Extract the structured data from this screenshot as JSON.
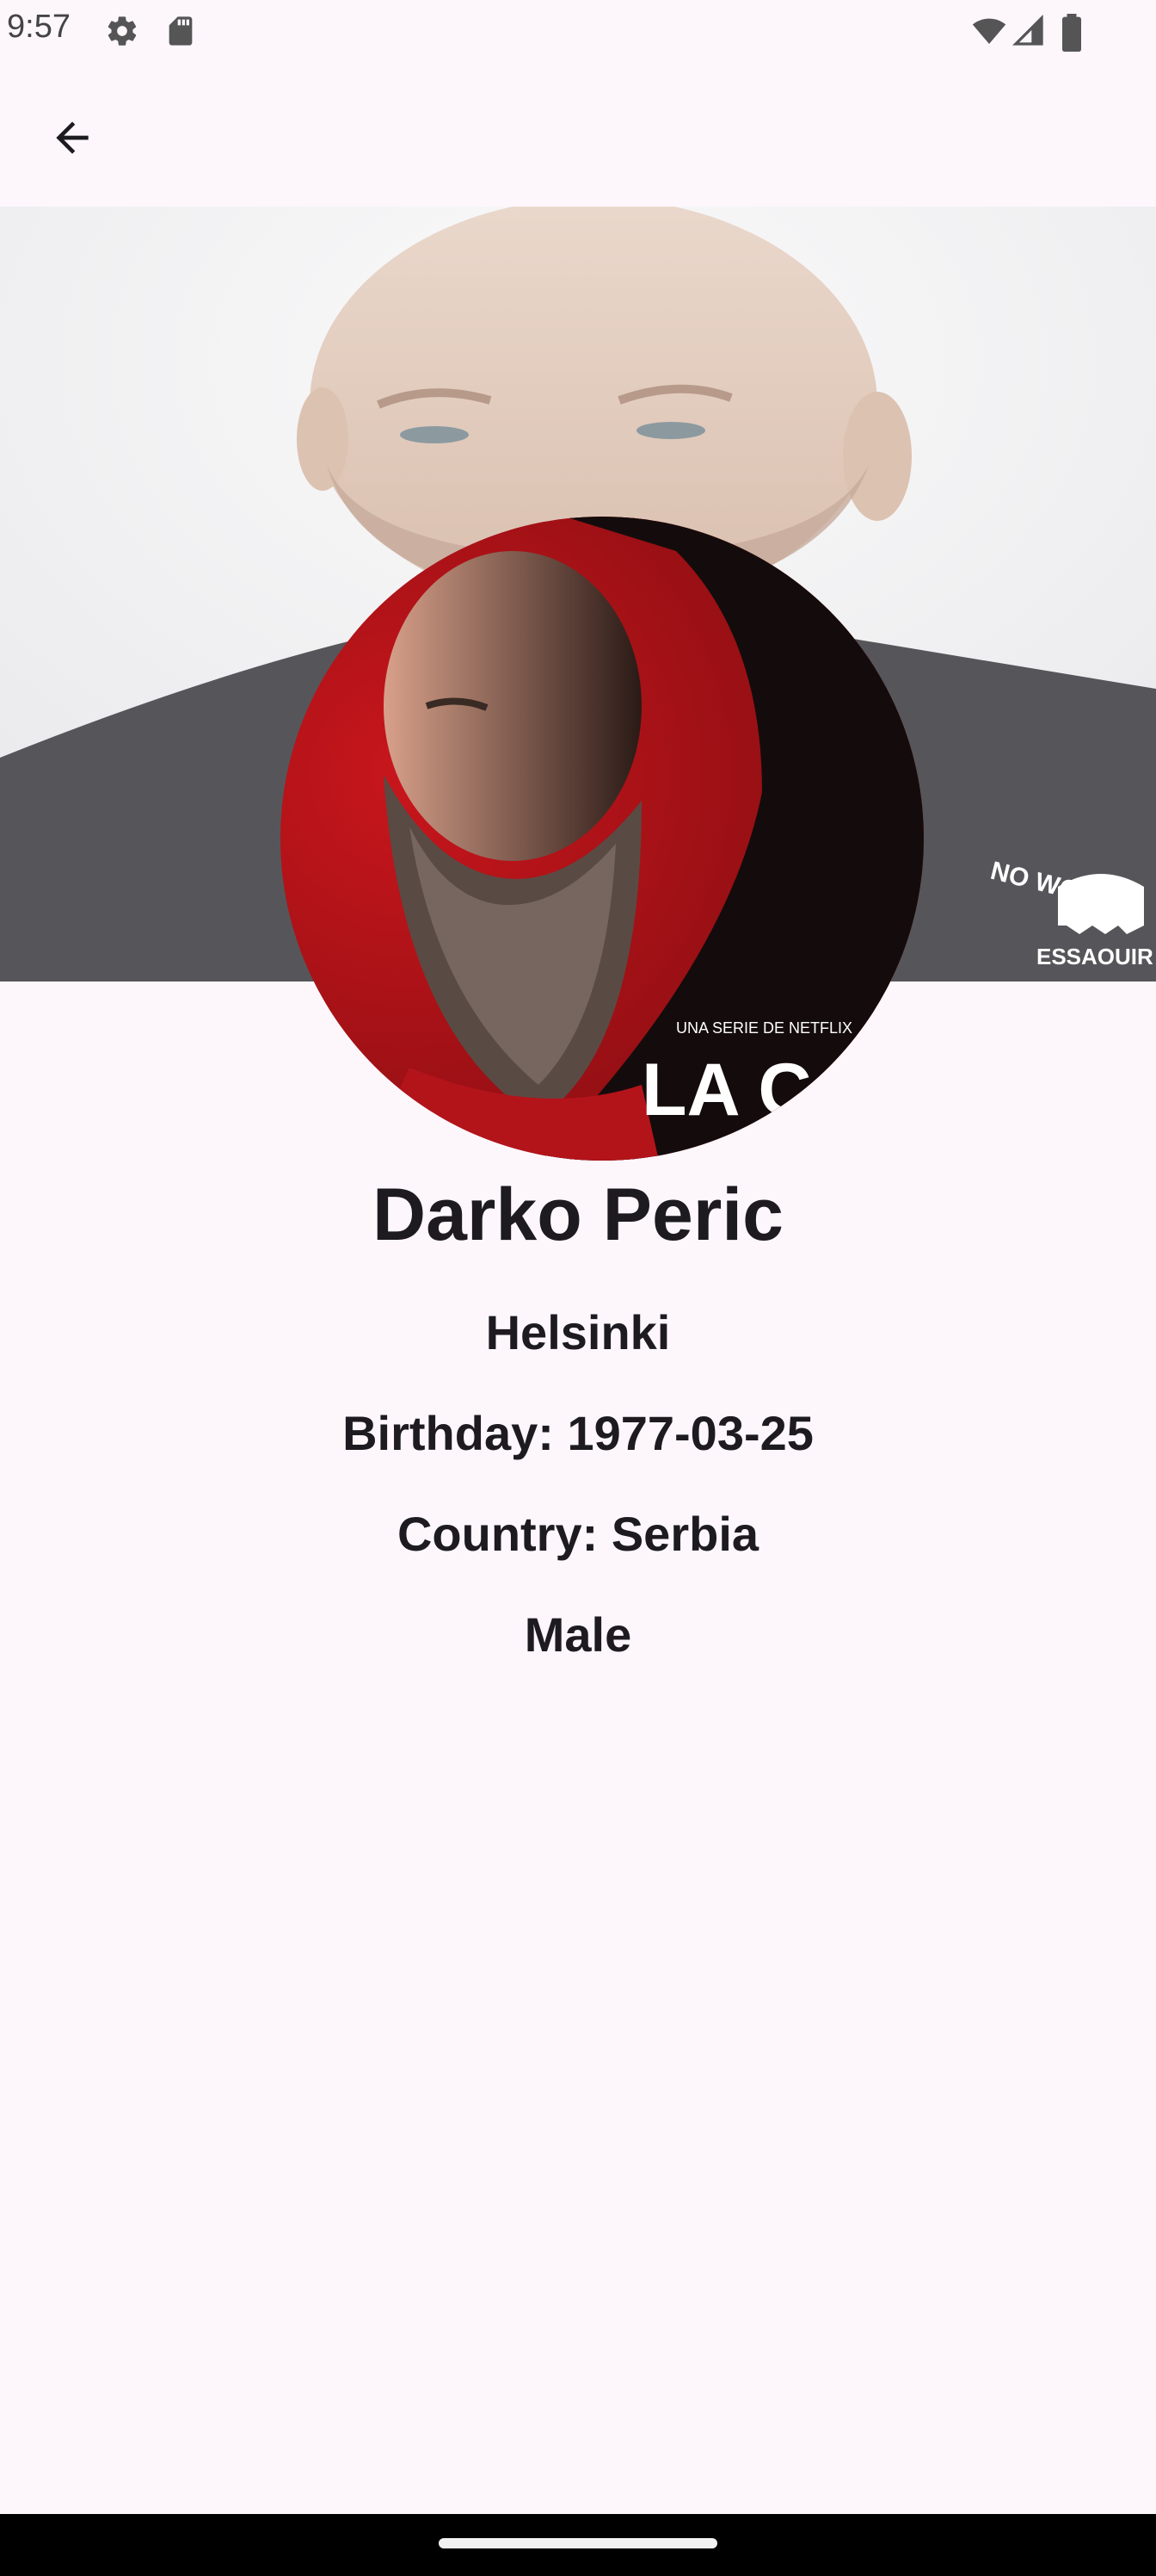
{
  "status_bar": {
    "time": "9:57",
    "icons": [
      "settings-icon",
      "sd-card-icon",
      "wifi-icon",
      "cell-signal-icon",
      "battery-icon"
    ]
  },
  "app_bar": {
    "back_icon": "arrow-back-icon"
  },
  "profile": {
    "name": "Darko Peric",
    "character": "Helsinki",
    "birthday": "Birthday: 1977-03-25",
    "country": "Country: Serbia",
    "gender": "Male"
  },
  "backdrop_image": {
    "shirt_text_1": "NO WORK T",
    "shirt_text_2": "ESSAOUIR"
  },
  "poster_image": {
    "small_text": "UNA SERIE DE NETFLIX",
    "title_text": "LA CAS"
  },
  "colors": {
    "background": "#fdf7fc",
    "poster_red": "#b0141a",
    "text": "#1d1b20"
  }
}
